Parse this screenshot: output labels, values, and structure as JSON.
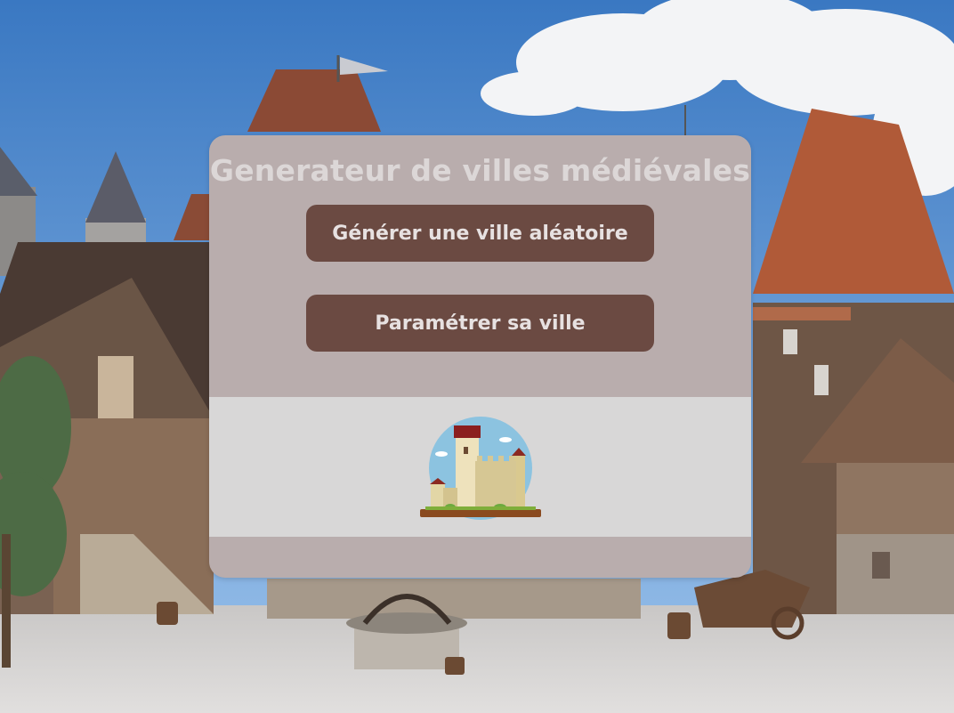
{
  "dialog": {
    "title": "Generateur de villes médiévales",
    "buttons": [
      {
        "label": "Générer une ville aléatoire"
      },
      {
        "label": "Paramétrer sa ville"
      }
    ],
    "logo_icon": "castle-icon"
  },
  "colors": {
    "panel": "#b9adad",
    "button": "#6b4a42",
    "button_text": "#e7e1e1",
    "title_text": "#dcd7d7",
    "logo_band": "#d8d7d7"
  }
}
